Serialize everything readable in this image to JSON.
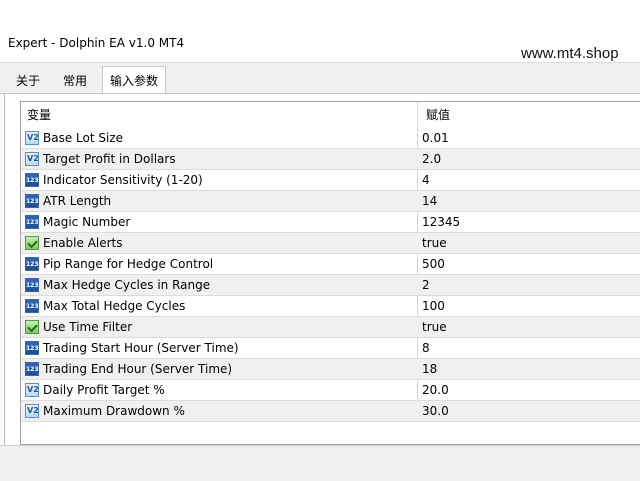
{
  "window": {
    "title": "Expert - Dolphin EA v1.0 MT4"
  },
  "watermark": {
    "text": "www.mt4.shop"
  },
  "tabs": [
    {
      "label": "关于"
    },
    {
      "label": "常用"
    },
    {
      "label": "输入参数",
      "selected": true
    }
  ],
  "grid": {
    "headers": {
      "variable": "变量",
      "value": "赋值"
    },
    "rows": [
      {
        "icon": "double-icon",
        "name": "Base Lot Size",
        "value": "0.01"
      },
      {
        "icon": "double-icon",
        "name": "Target Profit in Dollars",
        "value": "2.0"
      },
      {
        "icon": "integer-icon",
        "name": "Indicator Sensitivity (1-20)",
        "value": "4"
      },
      {
        "icon": "integer-icon",
        "name": "ATR Length",
        "value": "14"
      },
      {
        "icon": "integer-icon",
        "name": "Magic Number",
        "value": "12345"
      },
      {
        "icon": "bool-icon",
        "name": "Enable Alerts",
        "value": "true"
      },
      {
        "icon": "integer-icon",
        "name": "Pip Range for Hedge Control",
        "value": "500"
      },
      {
        "icon": "integer-icon",
        "name": "Max Hedge Cycles in Range",
        "value": "2"
      },
      {
        "icon": "integer-icon",
        "name": "Max Total Hedge Cycles",
        "value": "100"
      },
      {
        "icon": "bool-icon",
        "name": "Use Time Filter",
        "value": "true"
      },
      {
        "icon": "integer-icon",
        "name": "Trading Start Hour (Server Time)",
        "value": "8"
      },
      {
        "icon": "integer-icon",
        "name": "Trading End Hour (Server Time)",
        "value": "18"
      },
      {
        "icon": "double-icon",
        "name": "Daily Profit Target %",
        "value": "20.0"
      },
      {
        "icon": "double-icon",
        "name": "Maximum Drawdown %",
        "value": "30.0"
      }
    ]
  },
  "colors": {
    "alt_row": "#f0f0f0",
    "border": "#a5a5a5",
    "tab_strip": "#f0f0f0"
  }
}
